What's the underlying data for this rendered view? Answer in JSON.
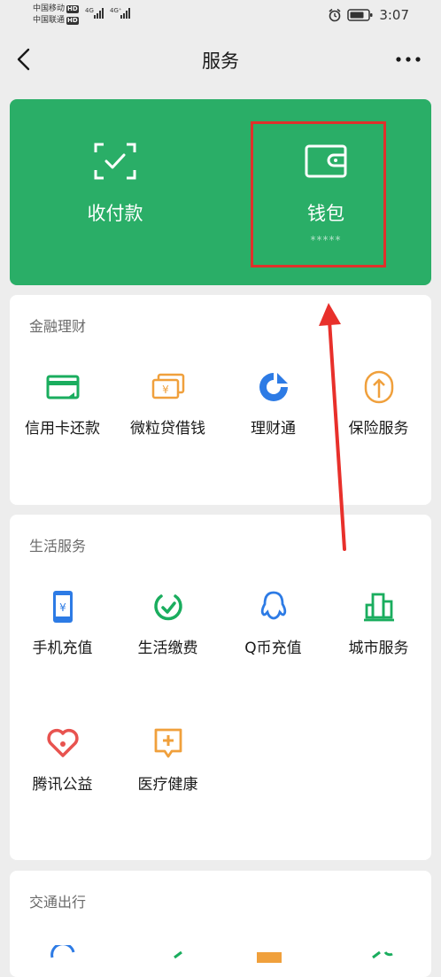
{
  "status_bar": {
    "carrier1": "中国移动",
    "carrier2": "中国联通",
    "hd": "HD",
    "net1": "4G",
    "net2": "4G⁺",
    "time": "3:07"
  },
  "header": {
    "title": "服务"
  },
  "pay_card": {
    "items": [
      {
        "label": "收付款",
        "sub": ""
      },
      {
        "label": "钱包",
        "sub": "*****"
      }
    ]
  },
  "sections": [
    {
      "title": "金融理财",
      "items": [
        {
          "label": "信用卡还款",
          "icon": "credit-card-icon"
        },
        {
          "label": "微粒贷借钱",
          "icon": "loan-icon"
        },
        {
          "label": "理财通",
          "icon": "wealth-icon"
        },
        {
          "label": "保险服务",
          "icon": "insurance-icon"
        }
      ]
    },
    {
      "title": "生活服务",
      "items": [
        {
          "label": "手机充值",
          "icon": "phone-topup-icon"
        },
        {
          "label": "生活缴费",
          "icon": "utility-bill-icon"
        },
        {
          "label": "Q币充值",
          "icon": "qq-coin-icon"
        },
        {
          "label": "城市服务",
          "icon": "city-service-icon"
        },
        {
          "label": "腾讯公益",
          "icon": "charity-icon"
        },
        {
          "label": "医疗健康",
          "icon": "medical-icon"
        }
      ]
    },
    {
      "title": "交通出行",
      "items": []
    }
  ],
  "colors": {
    "primary_green": "#2aae67",
    "highlight_red": "#e0302b",
    "background": "#ededed"
  }
}
